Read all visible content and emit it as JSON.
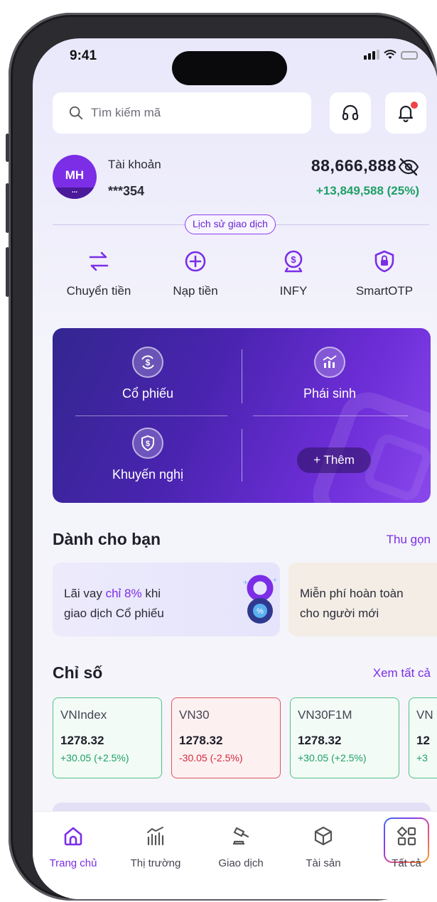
{
  "status": {
    "time": "9:41"
  },
  "search": {
    "placeholder": "Tìm kiếm mã"
  },
  "account": {
    "avatar_initials": "MH",
    "avatar_dots": "...",
    "label": "Tài khoản",
    "number": "***354",
    "balance": "88,666,888",
    "change": "+13,849,588 (25%)",
    "history_link": "Lịch sử giao dịch"
  },
  "quick_actions": [
    {
      "label": "Chuyển tiền",
      "icon": "transfer-icon"
    },
    {
      "label": "Nạp tiền",
      "icon": "plus-circle-icon"
    },
    {
      "label": "INFY",
      "icon": "dollar-badge-icon"
    },
    {
      "label": "SmartOTP",
      "icon": "shield-lock-icon"
    }
  ],
  "products": {
    "stocks": "Cổ phiếu",
    "derivatives": "Phái sinh",
    "recommend": "Khuyến nghị",
    "more": "+ Thêm"
  },
  "for_you": {
    "title": "Dành cho bạn",
    "link": "Thu gọn",
    "promo1": {
      "line1_pre": "Lãi vay ",
      "line1_hl": "chỉ 8%",
      "line1_post": " khi",
      "line2": "giao dịch Cổ phiếu"
    },
    "promo2": {
      "line1": "Miễn phí hoàn toàn",
      "line2": "cho người mới"
    }
  },
  "indices": {
    "title": "Chỉ số",
    "link": "Xem tất cả",
    "items": [
      {
        "name": "VNIndex",
        "value": "1278.32",
        "change": "+30.05 (+2.5%)",
        "trend": "up"
      },
      {
        "name": "VN30",
        "value": "1278.32",
        "change": "-30.05 (-2.5%)",
        "trend": "down"
      },
      {
        "name": "VN30F1M",
        "value": "1278.32",
        "change": "+30.05 (+2.5%)",
        "trend": "up"
      },
      {
        "name": "VN",
        "value": "12",
        "change": "+3",
        "trend": "up"
      }
    ]
  },
  "nav": [
    {
      "label": "Trang chủ",
      "icon": "home-icon",
      "active": true
    },
    {
      "label": "Thị trường",
      "icon": "market-chart-icon"
    },
    {
      "label": "Giao dịch",
      "icon": "gavel-icon"
    },
    {
      "label": "Tài sản",
      "icon": "box-icon"
    },
    {
      "label": "Tất cả",
      "icon": "grid-icon"
    }
  ],
  "colors": {
    "accent": "#7B2EE6",
    "up": "#1FA066",
    "down": "#D6293A"
  }
}
